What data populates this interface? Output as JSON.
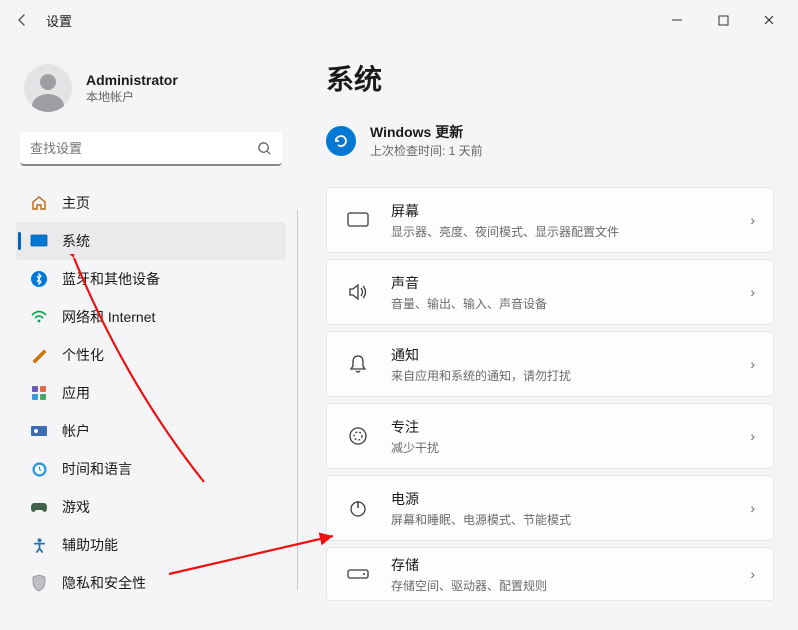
{
  "titlebar": {
    "title": "设置"
  },
  "user": {
    "name": "Administrator",
    "sub": "本地帐户"
  },
  "search": {
    "placeholder": "查找设置"
  },
  "nav": [
    {
      "key": "home",
      "label": "主页"
    },
    {
      "key": "system",
      "label": "系统",
      "selected": true
    },
    {
      "key": "bluetooth",
      "label": "蓝牙和其他设备"
    },
    {
      "key": "network",
      "label": "网络和 Internet"
    },
    {
      "key": "personalize",
      "label": "个性化"
    },
    {
      "key": "apps",
      "label": "应用"
    },
    {
      "key": "accounts",
      "label": "帐户"
    },
    {
      "key": "time",
      "label": "时间和语言"
    },
    {
      "key": "gaming",
      "label": "游戏"
    },
    {
      "key": "accessibility",
      "label": "辅助功能"
    },
    {
      "key": "privacy",
      "label": "隐私和安全性"
    }
  ],
  "page": {
    "title": "系统"
  },
  "update": {
    "title": "Windows 更新",
    "sub": "上次检查时间: 1 天前"
  },
  "cards": [
    {
      "title": "屏幕",
      "sub": "显示器、亮度、夜间模式、显示器配置文件"
    },
    {
      "title": "声音",
      "sub": "音量、输出、输入、声音设备"
    },
    {
      "title": "通知",
      "sub": "来自应用和系统的通知，请勿打扰"
    },
    {
      "title": "专注",
      "sub": "减少干扰"
    },
    {
      "title": "电源",
      "sub": "屏幕和睡眠、电源模式、节能模式"
    },
    {
      "title": "存储",
      "sub": "存储空间、驱动器、配置规则"
    }
  ]
}
